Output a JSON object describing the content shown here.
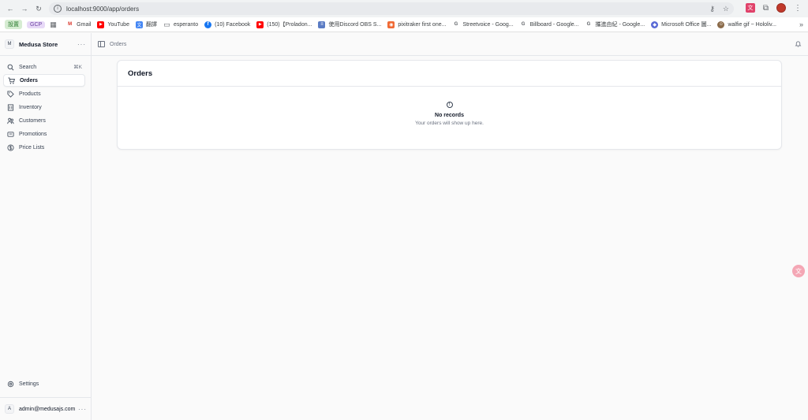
{
  "browser": {
    "url": "localhost:9000/app/orders",
    "bookmarks": [
      {
        "label": "",
        "icon": "apps-icon"
      },
      {
        "label": "Gmail",
        "icon": "gmail-icon",
        "color": "#d93025"
      },
      {
        "label": "YouTube",
        "icon": "youtube-icon",
        "color": "#ff0000"
      },
      {
        "label": "翻譯",
        "icon": "translate-icon",
        "color": "#4285f4"
      },
      {
        "label": "esperanto",
        "icon": "folder-icon",
        "color": "#5f6368"
      },
      {
        "label": "(10) Facebook",
        "icon": "facebook-icon",
        "color": "#1877f2"
      },
      {
        "label": "(150)【Proladon...",
        "icon": "youtube-icon",
        "color": "#ff0000"
      },
      {
        "label": "使用Discord OBS S...",
        "icon": "doc-icon",
        "color": "#5b7cc4"
      },
      {
        "label": "pixitraker first one...",
        "icon": "pixi-icon",
        "color": "#f06a35"
      },
      {
        "label": "Streetvoice - Goog...",
        "icon": "google-icon",
        "color": "#5f6368"
      },
      {
        "label": "Billboard - Google...",
        "icon": "google-icon",
        "color": "#5f6368"
      },
      {
        "label": "攜進由紀 - Google...",
        "icon": "google-icon",
        "color": "#5f6368"
      },
      {
        "label": "Microsoft Office 圖...",
        "icon": "office-icon",
        "color": "#5a6ad6"
      },
      {
        "label": "walfie gif ~ Hololiv...",
        "icon": "avatar-icon",
        "color": "#8b6b4a"
      }
    ],
    "chips": [
      {
        "label": "設置",
        "bg": "#d6ecd2",
        "fg": "#2e7d32"
      },
      {
        "label": "GCP",
        "bg": "#e7d9f7",
        "fg": "#6a3fa0"
      }
    ]
  },
  "store": {
    "initial": "M",
    "name": "Medusa Store",
    "more": "···"
  },
  "nav": {
    "search_label": "Search",
    "search_kbd": "⌘K",
    "items": [
      {
        "label": "Orders",
        "icon": "cart-icon"
      },
      {
        "label": "Products",
        "icon": "tag-icon"
      },
      {
        "label": "Inventory",
        "icon": "building-icon"
      },
      {
        "label": "Customers",
        "icon": "users-icon"
      },
      {
        "label": "Promotions",
        "icon": "receipt-icon"
      },
      {
        "label": "Price Lists",
        "icon": "currency-icon"
      }
    ]
  },
  "settings_label": "Settings",
  "user": {
    "initial": "A",
    "email": "admin@medusajs.com",
    "more": "···"
  },
  "header": {
    "breadcrumb": "Orders"
  },
  "card": {
    "title": "Orders",
    "empty_title": "No records",
    "empty_subtitle": "Your orders will show up here."
  }
}
